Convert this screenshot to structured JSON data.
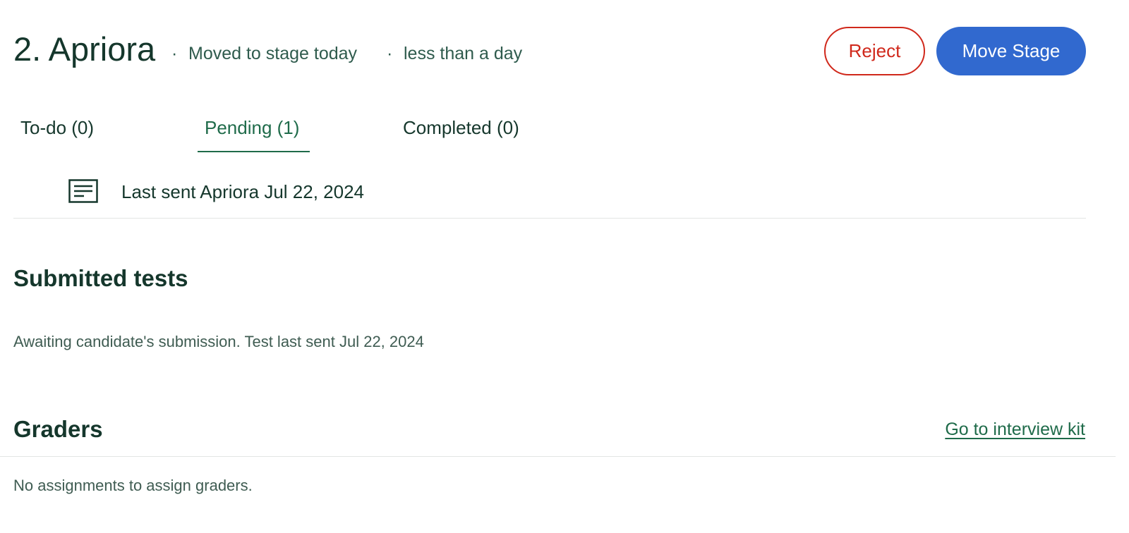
{
  "header": {
    "title": "2. Apriora",
    "separator": "·",
    "moved_text": "Moved to stage today",
    "duration_text": "less than a day",
    "reject_label": "Reject",
    "move_stage_label": "Move Stage"
  },
  "tabs": [
    {
      "label": "To-do (0)",
      "active": false
    },
    {
      "label": "Pending (1)",
      "active": true
    },
    {
      "label": "Completed (0)",
      "active": false
    }
  ],
  "pending": {
    "icon": "document-icon",
    "last_sent_text": "Last sent Apriora Jul 22, 2024"
  },
  "submitted_tests": {
    "heading": "Submitted tests",
    "status_text": "Awaiting candidate's submission. Test last sent Jul 22, 2024"
  },
  "graders": {
    "heading": "Graders",
    "link_label": "Go to interview kit",
    "empty_text": "No assignments to assign graders."
  },
  "colors": {
    "reject": "#d0281b",
    "primary": "#3169cf",
    "active_tab": "#1f6b4a",
    "text": "#15372c"
  }
}
